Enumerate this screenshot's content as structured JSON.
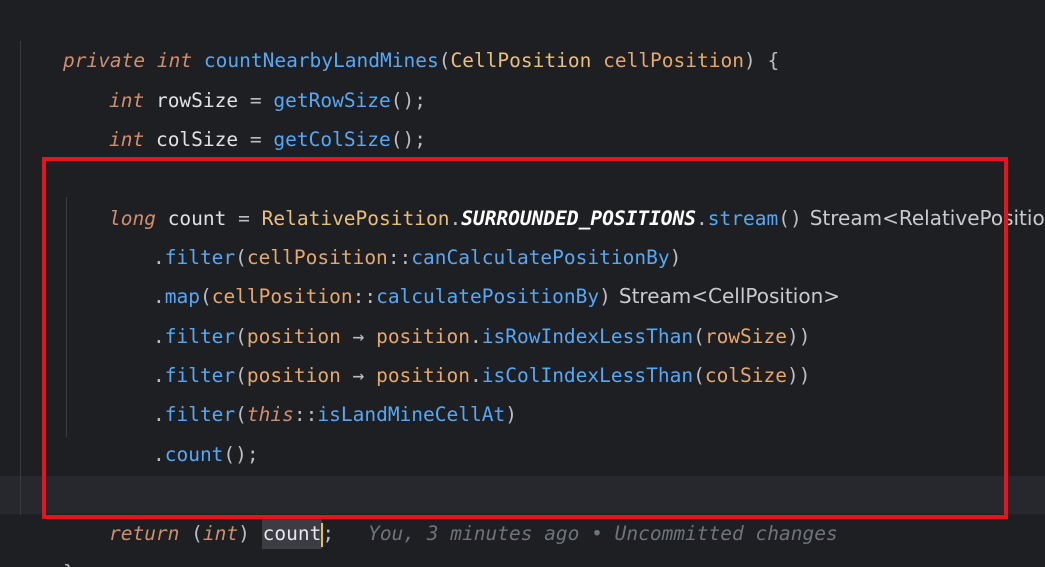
{
  "code": {
    "line1": {
      "modifier": "private",
      "return_type": "int",
      "method_name": "countNearbyLandMines",
      "open_paren": "(",
      "param_type": "CellPosition",
      "param_name": "cellPosition",
      "close_paren_brace": ") {"
    },
    "line2": {
      "type": "int",
      "var": "rowSize",
      "eq": " = ",
      "call": "getRowSize",
      "tail": "();"
    },
    "line3": {
      "type": "int",
      "var": "colSize",
      "eq": " = ",
      "call": "getColSize",
      "tail": "();"
    },
    "line5": {
      "type": "long",
      "var": "count",
      "eq": " = ",
      "cls": "RelativePosition",
      "dot": ".",
      "const": "SURROUNDED_POSITIONS",
      "dot2": ".",
      "call": "stream",
      "tail": "()",
      "hint": "Stream<RelativePosition>"
    },
    "line6": {
      "dot": ".",
      "call": "filter",
      "open": "(",
      "ref_obj": "cellPosition",
      "sep": "::",
      "ref_method": "canCalculatePositionBy",
      "close": ")"
    },
    "line7": {
      "dot": ".",
      "call": "map",
      "open": "(",
      "ref_obj": "cellPosition",
      "sep": "::",
      "ref_method": "calculatePositionBy",
      "close": ")",
      "hint": "Stream<CellPosition>"
    },
    "line8": {
      "dot": ".",
      "call": "filter",
      "open": "(",
      "lambda_param": "position",
      "arrow": " → ",
      "obj": "position",
      "dot2": ".",
      "method": "isRowIndexLessThan",
      "open2": "(",
      "arg": "rowSize",
      "close": "))"
    },
    "line9": {
      "dot": ".",
      "call": "filter",
      "open": "(",
      "lambda_param": "position",
      "arrow": " → ",
      "obj": "position",
      "dot2": ".",
      "method": "isColIndexLessThan",
      "open2": "(",
      "arg": "colSize",
      "close": "))"
    },
    "line10": {
      "dot": ".",
      "call": "filter",
      "open": "(",
      "self": "this",
      "sep": "::",
      "ref_method": "isLandMineCellAt",
      "close": ")"
    },
    "line11": {
      "dot": ".",
      "call": "count",
      "tail": "();"
    },
    "line13": {
      "kw": "return",
      "cast_open": " (",
      "cast_type": "int",
      "cast_close": ") ",
      "var": "count",
      "semi": ";",
      "blame": "You, 3 minutes ago • Uncommitted changes"
    },
    "line14": {
      "brace": "}"
    }
  },
  "colors": {
    "background": "#1e1f22",
    "highlight_box": "#e8131f",
    "keyword": "#cf8e6d",
    "function": "#56a8f5",
    "parameter": "#e5a86c"
  }
}
